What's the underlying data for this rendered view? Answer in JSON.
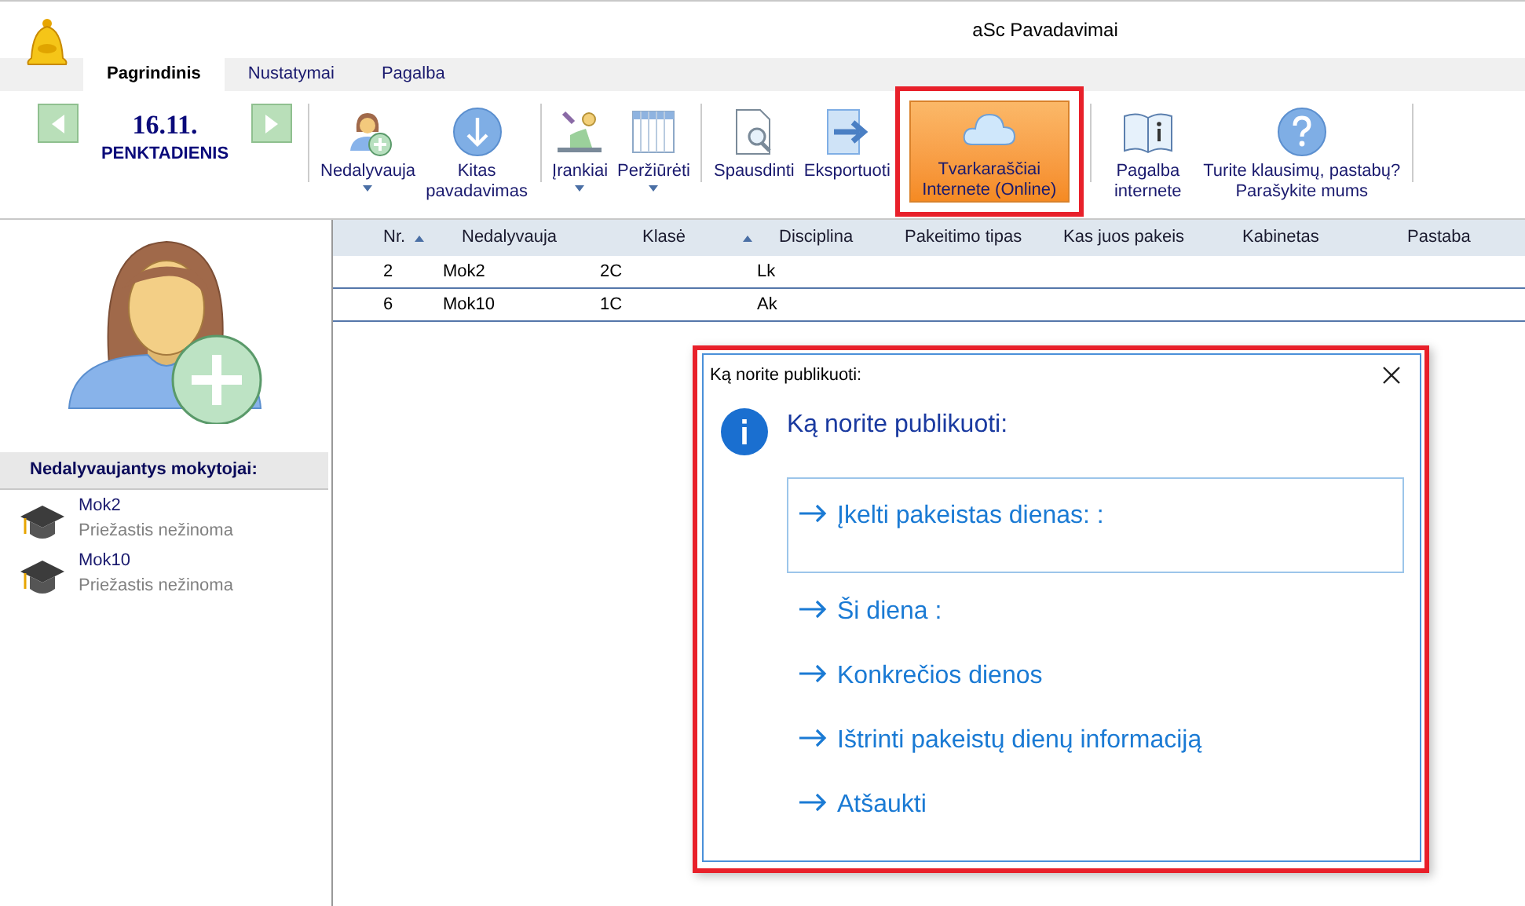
{
  "window": {
    "title": "aSc Pavadavimai"
  },
  "tabs": [
    {
      "label": "Pagrindinis",
      "selected": true
    },
    {
      "label": "Nustatymai",
      "selected": false
    },
    {
      "label": "Pagalba",
      "selected": false
    }
  ],
  "date_nav": {
    "date": "16.11.",
    "weekday": "PENKTADIENIS"
  },
  "toolbar_groups": [
    {
      "buttons": [
        {
          "kind": "absent",
          "label": "Nedalyvauja",
          "dropdown": true,
          "highlighted": false,
          "annotated": false
        },
        {
          "kind": "substitute",
          "label": "Kitas pavadavimas",
          "dropdown": false,
          "highlighted": false,
          "annotated": false
        }
      ]
    },
    {
      "buttons": [
        {
          "kind": "tools",
          "label": "Įrankiai",
          "dropdown": true,
          "highlighted": false,
          "annotated": false
        },
        {
          "kind": "view",
          "label": "Peržiūrėti",
          "dropdown": true,
          "highlighted": false,
          "annotated": false
        }
      ]
    },
    {
      "buttons": [
        {
          "kind": "print",
          "label": "Spausdinti",
          "dropdown": false,
          "highlighted": false,
          "annotated": false
        },
        {
          "kind": "export",
          "label": "Eksportuoti",
          "dropdown": false,
          "highlighted": false,
          "annotated": false
        },
        {
          "kind": "cloud",
          "label": "Tvarkaraščiai Internete (Online)",
          "dropdown": false,
          "highlighted": true,
          "annotated": true
        }
      ]
    },
    {
      "buttons": [
        {
          "kind": "book",
          "label": "Pagalba internete",
          "dropdown": false,
          "highlighted": false,
          "annotated": false
        },
        {
          "kind": "question",
          "label": "Turite klausimų, pastabų? Parašykite mums",
          "dropdown": false,
          "highlighted": false,
          "annotated": false
        }
      ]
    }
  ],
  "absent_panel": {
    "title": "Nedalyvaujantys mokytojai:",
    "teachers": [
      {
        "name": "Mok2",
        "reason": "Priežastis nežinoma"
      },
      {
        "name": "Mok10",
        "reason": "Priežastis nežinoma"
      }
    ]
  },
  "table": {
    "columns": [
      {
        "label": "Nr.",
        "sorted": true
      },
      {
        "label": "Nedalyvauja",
        "sorted": false
      },
      {
        "label": "Klasė",
        "sorted": true
      },
      {
        "label": "Disciplina",
        "sorted": false
      },
      {
        "label": "Pakeitimo tipas",
        "sorted": false
      },
      {
        "label": "Kas juos pakeis",
        "sorted": false
      },
      {
        "label": "Kabinetas",
        "sorted": false
      },
      {
        "label": "Pastaba",
        "sorted": false
      }
    ],
    "rows": [
      [
        "2",
        "Mok2",
        "2C",
        "Lk"
      ],
      [
        "6",
        "Mok10",
        "1C",
        "Ak"
      ]
    ]
  },
  "dialog": {
    "title": "Ką norite publikuoti:",
    "heading": "Ką norite publikuoti:",
    "annotated": true,
    "options": [
      {
        "label": "Įkelti pakeistas dienas: :",
        "selected": true
      },
      {
        "label": "Ši diena :",
        "selected": false
      },
      {
        "label": "Konkrečios dienos",
        "selected": false
      },
      {
        "label": "Ištrinti pakeistų dienų informaciją",
        "selected": false
      },
      {
        "label": "Atšaukti",
        "selected": false
      }
    ]
  }
}
